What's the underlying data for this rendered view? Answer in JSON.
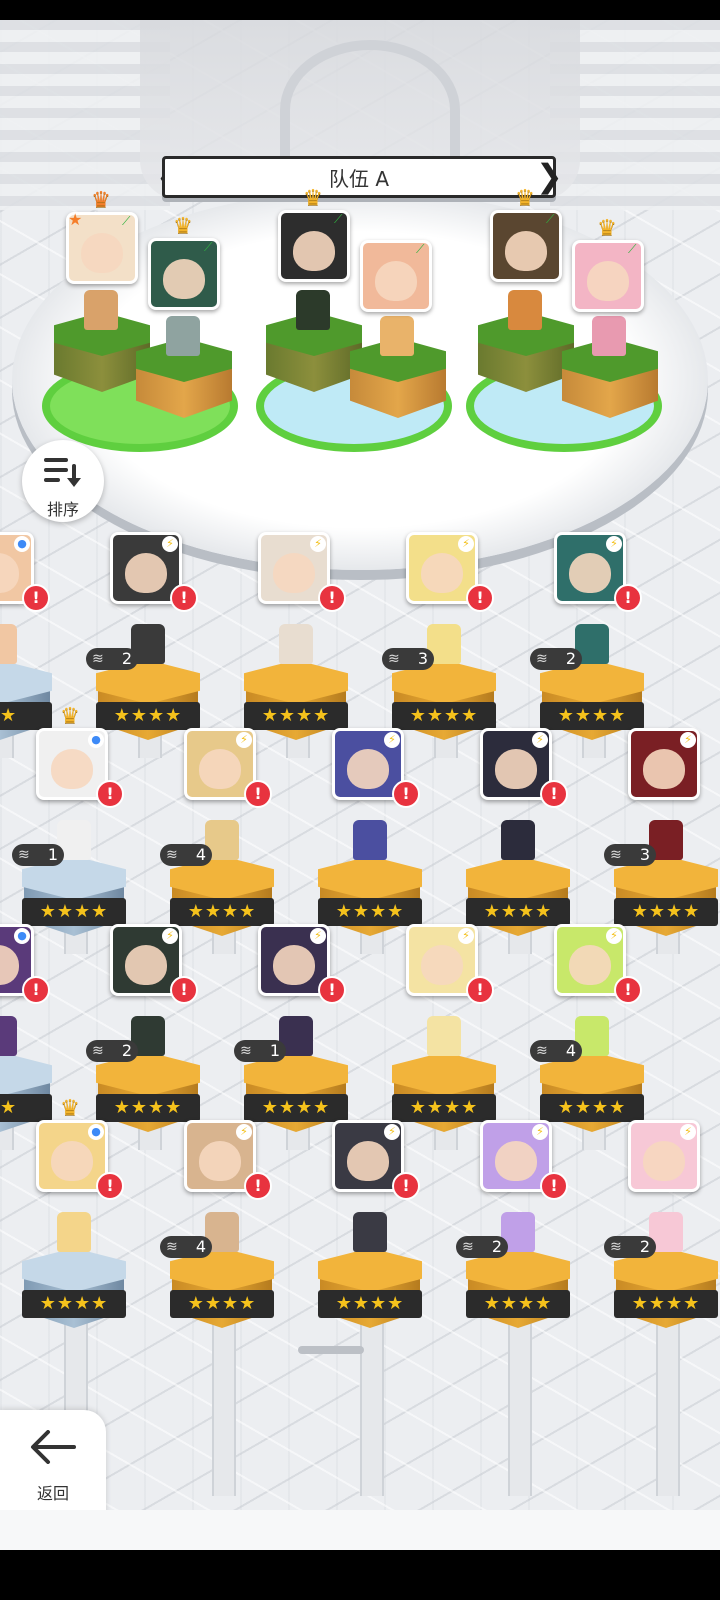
{
  "team": {
    "title": "队伍 A",
    "prev_label": "❮",
    "next_label": "❯"
  },
  "sort_button": {
    "label": "排序",
    "icon": "sort-icon"
  },
  "back_button": {
    "label": "返回",
    "icon": "back-arrow-icon"
  },
  "colors": {
    "pedestal_gold": "#f2b43b",
    "platform_green": "#5fcf3f",
    "alert_red": "#e8333f",
    "star_gold": "#f5c21c"
  },
  "team_slots": [
    {
      "crown": "orange",
      "star_badge": true,
      "role": "leaf"
    },
    {
      "crown": "gold",
      "role": "leaf"
    },
    {
      "crown": "gold",
      "role": "leaf"
    },
    {
      "crown": "",
      "role": "leaf"
    },
    {
      "crown": "gold",
      "role": "leaf"
    },
    {
      "crown": "gold",
      "role": "leaf"
    }
  ],
  "roster": [
    {
      "stars": "★★",
      "cp": "",
      "element": "dot",
      "crown": false,
      "pedestal": "blue",
      "alert": "!"
    },
    {
      "stars": "★★★★",
      "cp": "2",
      "element": "bolt",
      "crown": false,
      "pedestal": "gold",
      "alert": "!"
    },
    {
      "stars": "★★★★",
      "cp": "",
      "element": "bolt",
      "crown": false,
      "pedestal": "gold",
      "alert": "!"
    },
    {
      "stars": "★★★★",
      "cp": "3",
      "element": "bolt",
      "crown": false,
      "pedestal": "gold",
      "alert": "!"
    },
    {
      "stars": "★★★★",
      "cp": "2",
      "element": "bolt",
      "crown": false,
      "pedestal": "gold",
      "alert": "!"
    },
    {
      "stars": "★★★★",
      "cp": "1",
      "element": "dot",
      "crown": true,
      "pedestal": "blue",
      "alert": "!"
    },
    {
      "stars": "★★★★",
      "cp": "4",
      "element": "bolt",
      "crown": false,
      "pedestal": "gold",
      "alert": "!"
    },
    {
      "stars": "★★★★",
      "cp": "",
      "element": "bolt",
      "crown": false,
      "pedestal": "gold",
      "alert": "!"
    },
    {
      "stars": "★★★★",
      "cp": "",
      "element": "bolt",
      "crown": false,
      "pedestal": "gold",
      "alert": "!"
    },
    {
      "stars": "★★★★",
      "cp": "3",
      "element": "bolt",
      "crown": false,
      "pedestal": "gold",
      "alert": ""
    },
    {
      "stars": "★★",
      "cp": "",
      "element": "dot",
      "crown": false,
      "pedestal": "blue",
      "alert": "!"
    },
    {
      "stars": "★★★★",
      "cp": "2",
      "element": "bolt",
      "crown": false,
      "pedestal": "gold",
      "alert": "!"
    },
    {
      "stars": "★★★★",
      "cp": "1",
      "element": "bolt",
      "crown": false,
      "pedestal": "gold",
      "alert": "!"
    },
    {
      "stars": "★★★★",
      "cp": "",
      "element": "bolt",
      "crown": false,
      "pedestal": "gold",
      "alert": "!"
    },
    {
      "stars": "★★★★",
      "cp": "4",
      "element": "bolt",
      "crown": false,
      "pedestal": "gold",
      "alert": "!"
    },
    {
      "stars": "★★★★",
      "cp": "",
      "element": "dot",
      "crown": true,
      "pedestal": "blue",
      "alert": "!"
    },
    {
      "stars": "★★★★",
      "cp": "4",
      "element": "bolt",
      "crown": false,
      "pedestal": "gold",
      "alert": "!"
    },
    {
      "stars": "★★★★",
      "cp": "",
      "element": "bolt",
      "crown": false,
      "pedestal": "gold",
      "alert": "!"
    },
    {
      "stars": "★★★★",
      "cp": "2",
      "element": "bolt",
      "crown": false,
      "pedestal": "gold",
      "alert": "!"
    },
    {
      "stars": "★★★★",
      "cp": "2",
      "element": "bolt",
      "crown": false,
      "pedestal": "gold",
      "alert": ""
    }
  ]
}
